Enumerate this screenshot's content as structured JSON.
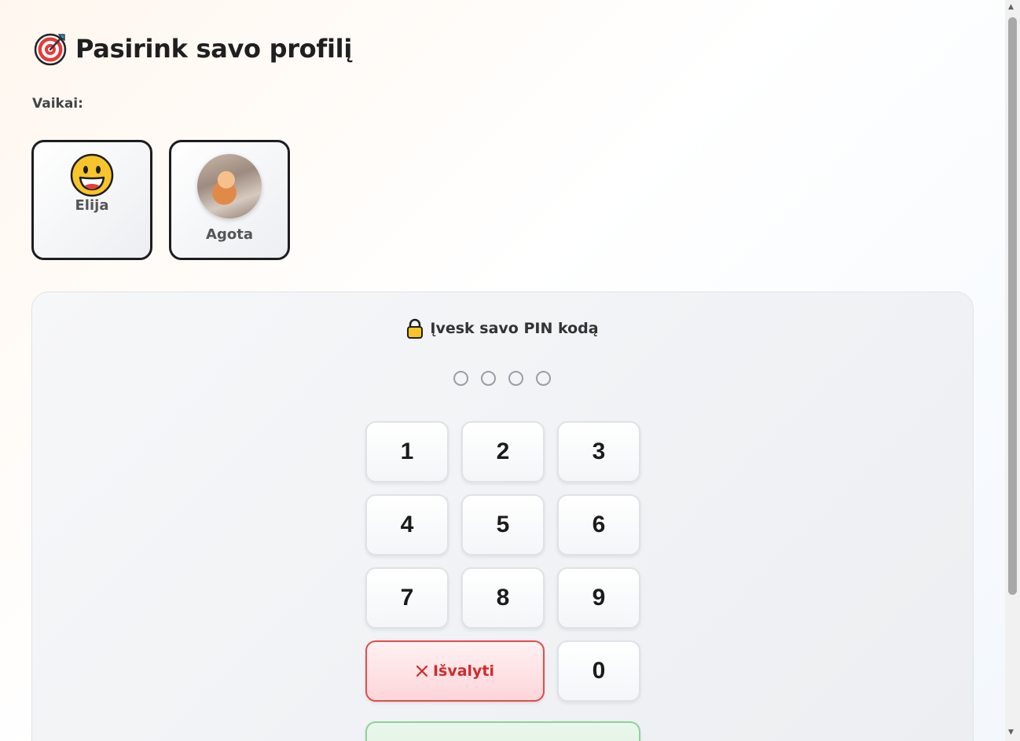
{
  "header": {
    "title": "Pasirink savo profilį",
    "icon": "target-icon"
  },
  "profiles_section": {
    "label": "Vaikai:"
  },
  "profiles": [
    {
      "name": "Elija",
      "avatar": "grinning-face-emoji"
    },
    {
      "name": "Agota",
      "avatar": "photo"
    }
  ],
  "pin": {
    "title": "Įvesk savo PIN kodą",
    "icon": "lock-icon",
    "digits_entered": 0,
    "digits_total": 4
  },
  "keypad": {
    "keys": [
      "1",
      "2",
      "3",
      "4",
      "5",
      "6",
      "7",
      "8",
      "9",
      "0"
    ],
    "clear_label": "Išvalyti"
  },
  "colors": {
    "clear_accent": "#e34d4d",
    "confirm_accent": "#8fd19a",
    "card_border": "#1d1d1f"
  }
}
